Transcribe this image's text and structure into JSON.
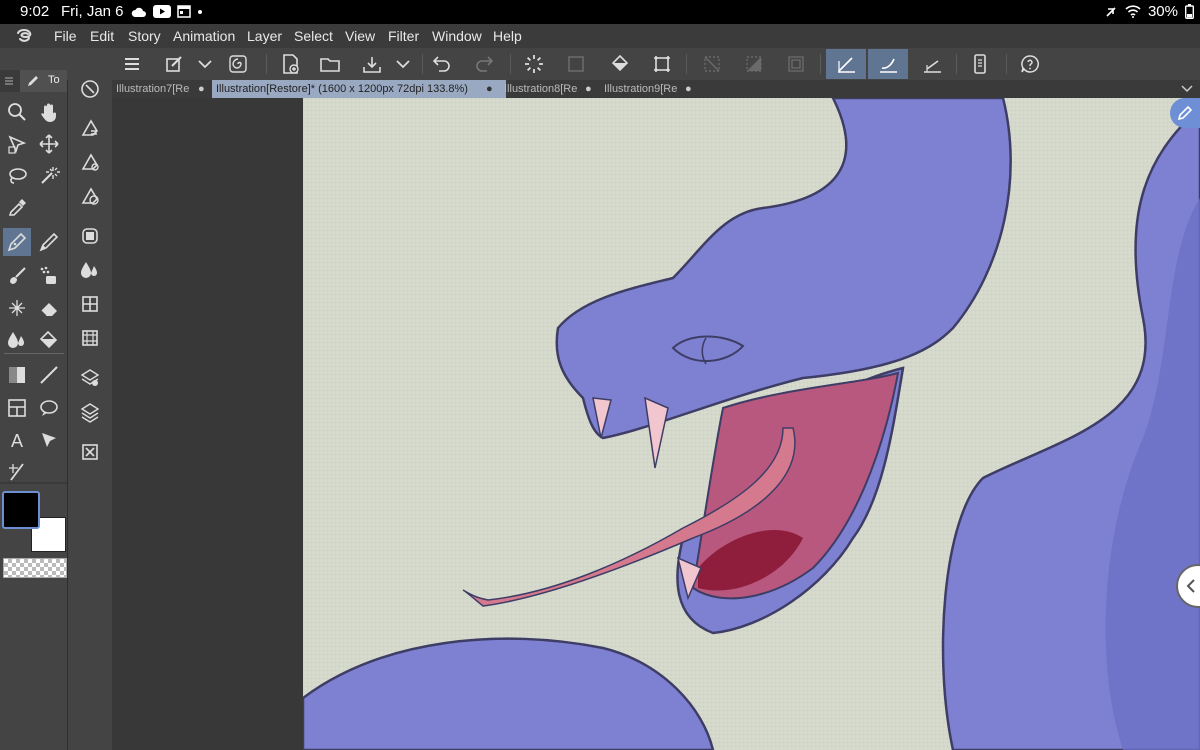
{
  "status_bar": {
    "time": "9:02",
    "date": "Fri, Jan 6",
    "battery": "30%"
  },
  "menu": [
    "File",
    "Edit",
    "Story",
    "Animation",
    "Layer",
    "Select",
    "View",
    "Filter",
    "Window",
    "Help"
  ],
  "tool_panel": {
    "tab_label": "To"
  },
  "tabs": [
    {
      "label": "Illustration7[Re",
      "active": false
    },
    {
      "label": "Illustration[Restore]* (1600 x 1200px 72dpi 133.8%)",
      "active": true
    },
    {
      "label": "Illustration8[Re",
      "active": false
    },
    {
      "label": "Illustration9[Re",
      "active": false
    }
  ],
  "colors": {
    "main_color": "#000000",
    "sub_color": "#ffffff",
    "selection_highlight": "#5f7591",
    "canvas_paper": "#d5d9cc",
    "snake_body": "#7f82cf"
  },
  "icons": {
    "tools": [
      "zoom-icon",
      "hand-icon",
      "operation-icon",
      "move-layer-icon",
      "lasso-select-icon",
      "magic-wand-icon",
      "eyedropper-icon",
      "pen-icon",
      "pencil-icon",
      "brush-icon",
      "airbrush-icon",
      "decoration-icon",
      "eraser-icon",
      "blend-icon",
      "fill-icon",
      "gradient-icon",
      "figure-line-icon",
      "frame-border-icon",
      "speech-balloon-icon",
      "text-icon",
      "correct-line-icon",
      "ruler-icon"
    ],
    "subtools": [
      "rotate-view-icon",
      "subtool-1-icon",
      "subtool-2-icon",
      "subtool-3-icon",
      "subtool-4-icon",
      "subtool-5-icon",
      "subtool-6-icon",
      "subtool-7-icon",
      "subtool-8-icon",
      "subtool-9-icon",
      "subtool-10-icon"
    ]
  }
}
